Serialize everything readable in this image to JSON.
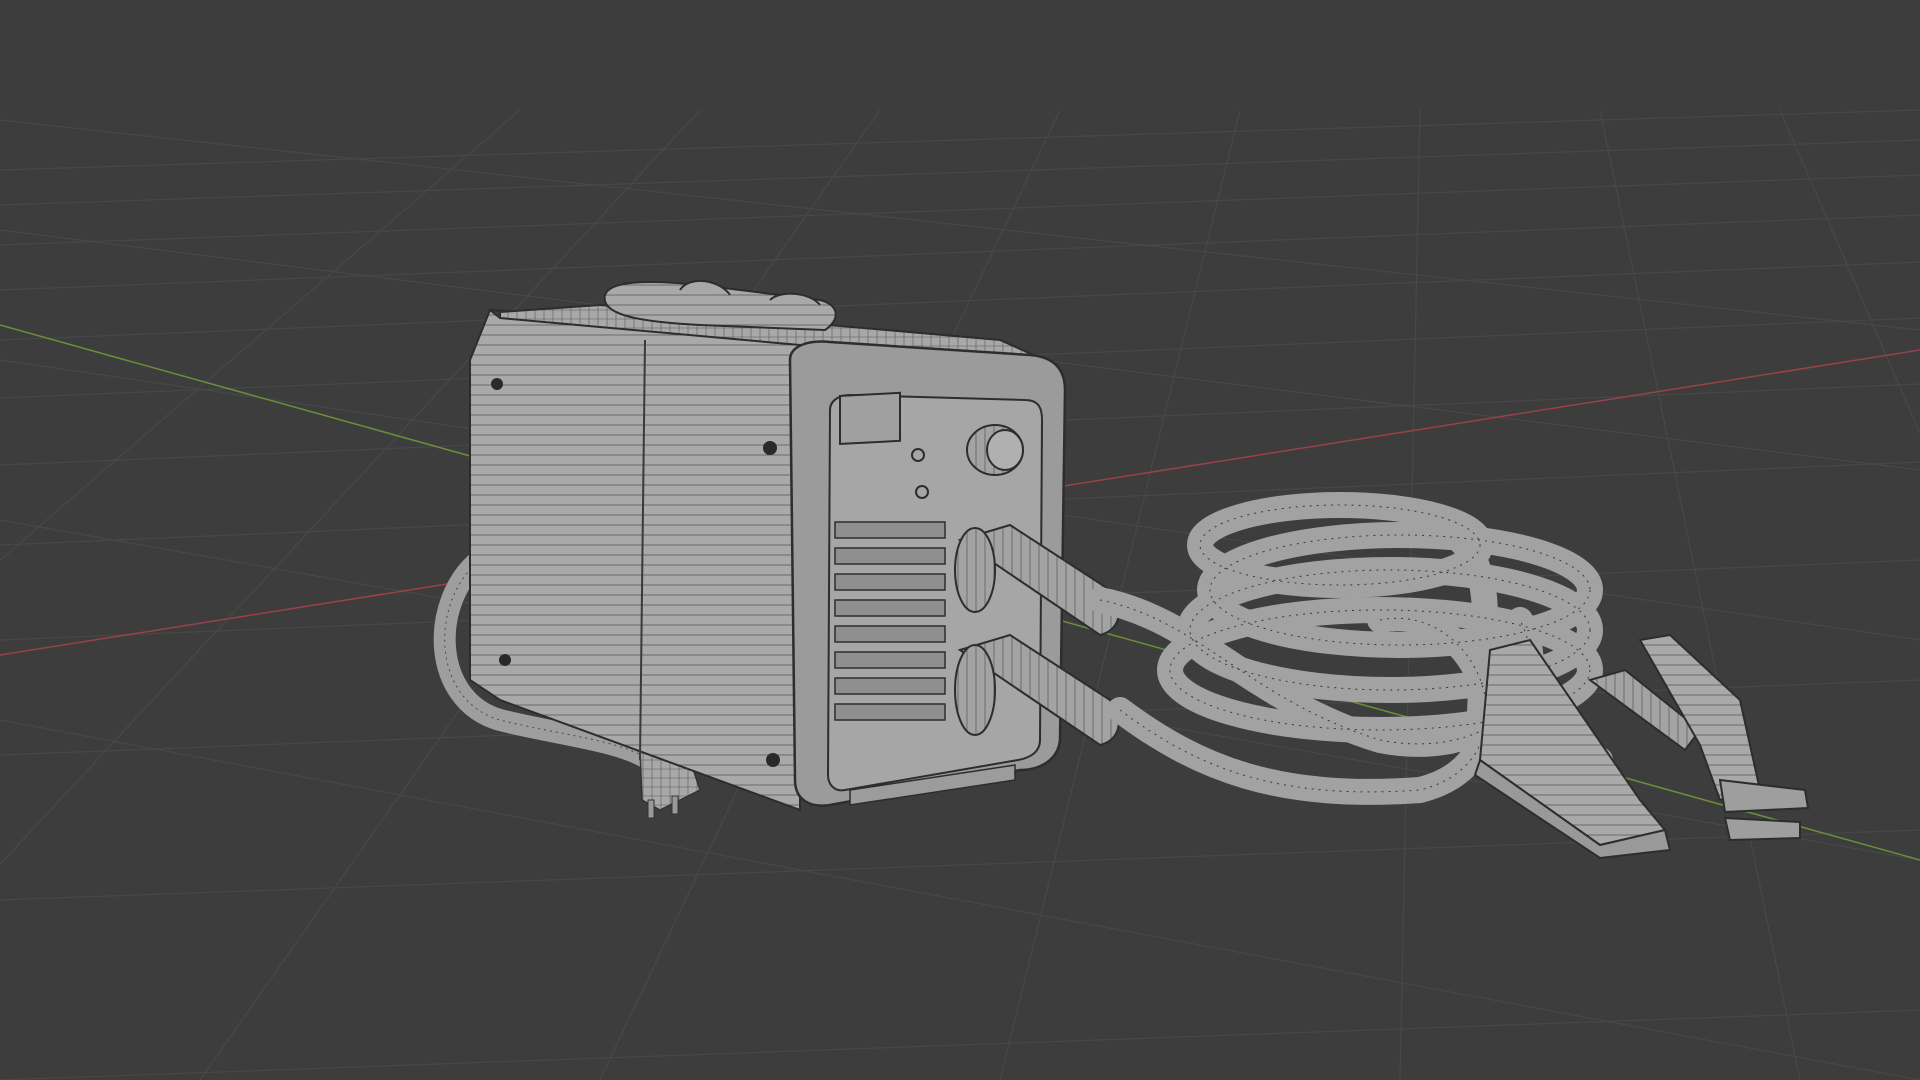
{
  "viewport": {
    "background": "#3d3d3d",
    "grid_color": "#4a4a4a",
    "x_axis_color": "#b0474e",
    "y_axis_color": "#6f9a3a",
    "wire_color": "#2a2a2a",
    "model_color": "#a7a7a7"
  },
  "scene": {
    "objects": [
      "welder-body",
      "power-cord",
      "plug",
      "cable-coil",
      "ground-clamp",
      "electrode-holder"
    ]
  }
}
